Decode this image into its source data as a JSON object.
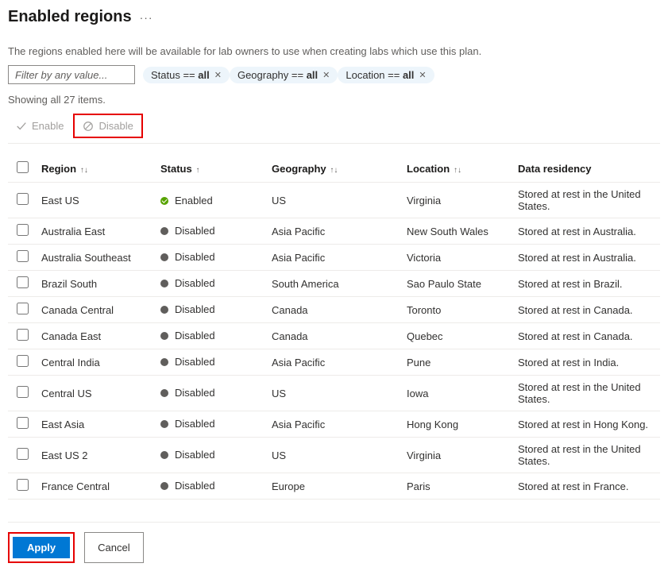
{
  "page_title": "Enabled regions",
  "description": "The regions enabled here will be available for lab owners to use when creating labs which use this plan.",
  "filter_placeholder": "Filter by any value...",
  "chips": [
    {
      "key": "Status",
      "op": "==",
      "value": "all"
    },
    {
      "key": "Geography",
      "op": "==",
      "value": "all"
    },
    {
      "key": "Location",
      "op": "==",
      "value": "all"
    }
  ],
  "count_label": "Showing all 27 items.",
  "actions": {
    "enable": "Enable",
    "disable": "Disable"
  },
  "columns": {
    "region": "Region",
    "status": "Status",
    "geography": "Geography",
    "location": "Location",
    "residency": "Data residency"
  },
  "status_labels": {
    "enabled": "Enabled",
    "disabled": "Disabled"
  },
  "rows": [
    {
      "region": "East US",
      "status": "enabled",
      "geography": "US",
      "location": "Virginia",
      "residency": "Stored at rest in the United States."
    },
    {
      "region": "Australia East",
      "status": "disabled",
      "geography": "Asia Pacific",
      "location": "New South Wales",
      "residency": "Stored at rest in Australia."
    },
    {
      "region": "Australia Southeast",
      "status": "disabled",
      "geography": "Asia Pacific",
      "location": "Victoria",
      "residency": "Stored at rest in Australia."
    },
    {
      "region": "Brazil South",
      "status": "disabled",
      "geography": "South America",
      "location": "Sao Paulo State",
      "residency": "Stored at rest in Brazil."
    },
    {
      "region": "Canada Central",
      "status": "disabled",
      "geography": "Canada",
      "location": "Toronto",
      "residency": "Stored at rest in Canada."
    },
    {
      "region": "Canada East",
      "status": "disabled",
      "geography": "Canada",
      "location": "Quebec",
      "residency": "Stored at rest in Canada."
    },
    {
      "region": "Central India",
      "status": "disabled",
      "geography": "Asia Pacific",
      "location": "Pune",
      "residency": "Stored at rest in India."
    },
    {
      "region": "Central US",
      "status": "disabled",
      "geography": "US",
      "location": "Iowa",
      "residency": "Stored at rest in the United States."
    },
    {
      "region": "East Asia",
      "status": "disabled",
      "geography": "Asia Pacific",
      "location": "Hong Kong",
      "residency": "Stored at rest in Hong Kong."
    },
    {
      "region": "East US 2",
      "status": "disabled",
      "geography": "US",
      "location": "Virginia",
      "residency": "Stored at rest in the United States."
    },
    {
      "region": "France Central",
      "status": "disabled",
      "geography": "Europe",
      "location": "Paris",
      "residency": "Stored at rest in France."
    }
  ],
  "buttons": {
    "apply": "Apply",
    "cancel": "Cancel"
  }
}
